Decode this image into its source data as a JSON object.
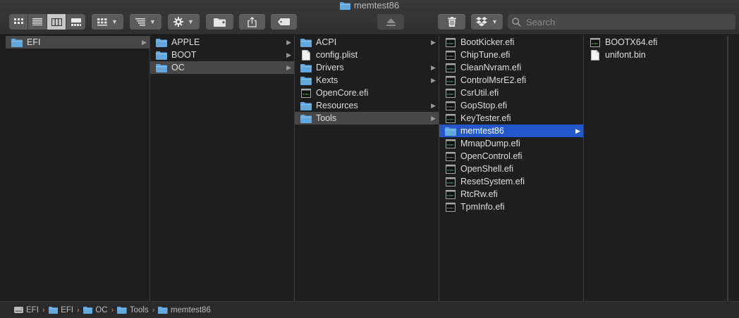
{
  "window": {
    "title": "memtest86"
  },
  "toolbar": {
    "search_placeholder": "Search",
    "view_modes": [
      "icon-view",
      "list-view",
      "column-view",
      "gallery-view"
    ],
    "active_view": "column-view"
  },
  "columns": [
    {
      "items": [
        {
          "label": "EFI",
          "icon": "folder-icon",
          "arrow": true,
          "state": "selected-inactive"
        }
      ]
    },
    {
      "items": [
        {
          "label": "APPLE",
          "icon": "folder-icon",
          "arrow": true
        },
        {
          "label": "BOOT",
          "icon": "folder-icon",
          "arrow": true
        },
        {
          "label": "OC",
          "icon": "folder-icon",
          "arrow": true,
          "state": "selected-inactive"
        }
      ]
    },
    {
      "items": [
        {
          "label": "ACPI",
          "icon": "folder-icon",
          "arrow": true
        },
        {
          "label": "config.plist",
          "icon": "document-icon",
          "arrow": false
        },
        {
          "label": "Drivers",
          "icon": "folder-icon",
          "arrow": true
        },
        {
          "label": "Kexts",
          "icon": "folder-icon",
          "arrow": true
        },
        {
          "label": "OpenCore.efi",
          "icon": "executable-icon",
          "arrow": false
        },
        {
          "label": "Resources",
          "icon": "folder-icon",
          "arrow": true
        },
        {
          "label": "Tools",
          "icon": "folder-icon",
          "arrow": true,
          "state": "selected-inactive"
        }
      ]
    },
    {
      "items": [
        {
          "label": "BootKicker.efi",
          "icon": "executable-icon",
          "arrow": false
        },
        {
          "label": "ChipTune.efi",
          "icon": "executable-icon",
          "arrow": false
        },
        {
          "label": "CleanNvram.efi",
          "icon": "executable-icon",
          "arrow": false
        },
        {
          "label": "ControlMsrE2.efi",
          "icon": "executable-icon",
          "arrow": false
        },
        {
          "label": "CsrUtil.efi",
          "icon": "executable-icon",
          "arrow": false
        },
        {
          "label": "GopStop.efi",
          "icon": "executable-icon",
          "arrow": false
        },
        {
          "label": "KeyTester.efi",
          "icon": "executable-icon",
          "arrow": false
        },
        {
          "label": "memtest86",
          "icon": "folder-icon",
          "arrow": true,
          "state": "selected-active"
        },
        {
          "label": "MmapDump.efi",
          "icon": "executable-icon",
          "arrow": false
        },
        {
          "label": "OpenControl.efi",
          "icon": "executable-icon",
          "arrow": false
        },
        {
          "label": "OpenShell.efi",
          "icon": "executable-icon",
          "arrow": false
        },
        {
          "label": "ResetSystem.efi",
          "icon": "executable-icon",
          "arrow": false
        },
        {
          "label": "RtcRw.efi",
          "icon": "executable-icon",
          "arrow": false
        },
        {
          "label": "TpmInfo.efi",
          "icon": "executable-icon",
          "arrow": false
        }
      ]
    },
    {
      "items": [
        {
          "label": "BOOTX64.efi",
          "icon": "executable-icon",
          "arrow": false
        },
        {
          "label": "unifont.bin",
          "icon": "document-icon",
          "arrow": false
        }
      ]
    }
  ],
  "pathbar": {
    "crumbs": [
      {
        "label": "EFI",
        "icon": "disk-icon"
      },
      {
        "label": "EFI",
        "icon": "folder-icon"
      },
      {
        "label": "OC",
        "icon": "folder-icon"
      },
      {
        "label": "Tools",
        "icon": "folder-icon"
      },
      {
        "label": "memtest86",
        "icon": "folder-icon"
      }
    ],
    "separator": "›"
  },
  "colors": {
    "folder": "#62a8dd",
    "selection_active": "#2457c9",
    "selection_inactive": "#474747",
    "background": "#1e1e1e"
  }
}
